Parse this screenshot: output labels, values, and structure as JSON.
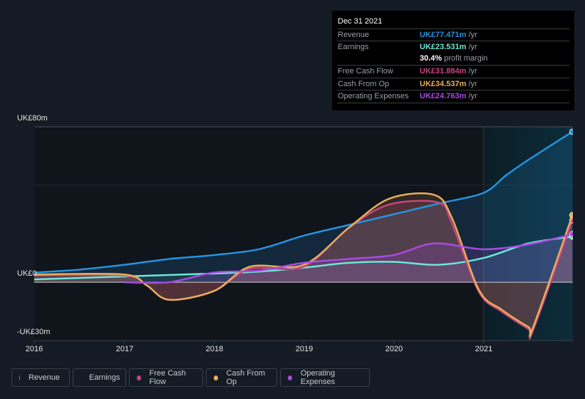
{
  "tooltip": {
    "date": "Dec 31 2021",
    "rows": [
      {
        "label": "Revenue",
        "value": "UK£77.471m",
        "unit": " /yr",
        "color": "#2394df"
      },
      {
        "label": "Earnings",
        "value": "UK£23.531m",
        "unit": " /yr",
        "color": "#6ee7d5"
      },
      {
        "label": "",
        "value": "30.4%",
        "unit": " profit margin",
        "color": "#ffffff"
      },
      {
        "label": "Free Cash Flow",
        "value": "UK£31.884m",
        "unit": " /yr",
        "color": "#c5467e"
      },
      {
        "label": "Cash From Op",
        "value": "UK£34.537m",
        "unit": " /yr",
        "color": "#e9ad5b"
      },
      {
        "label": "Operating Expenses",
        "value": "UK£24.763m",
        "unit": " /yr",
        "color": "#a94ae3"
      }
    ]
  },
  "legend": [
    {
      "label": "Revenue",
      "color": "#2394df"
    },
    {
      "label": "Earnings",
      "color": "#6ee7d5"
    },
    {
      "label": "Free Cash Flow",
      "color": "#c5467e"
    },
    {
      "label": "Cash From Op",
      "color": "#e9ad5b"
    },
    {
      "label": "Operating Expenses",
      "color": "#a94ae3"
    }
  ],
  "chart_data": {
    "type": "area",
    "title": "",
    "xlabel": "",
    "ylabel": "",
    "y_tick_labels": [
      "UK£80m",
      "UK£0",
      "-UK£30m"
    ],
    "y_ticks": [
      80,
      0,
      -30
    ],
    "ylim": [
      -30,
      80
    ],
    "xlim": [
      2016,
      2022
    ],
    "x_tick_labels": [
      "2016",
      "2017",
      "2018",
      "2019",
      "2020",
      "2021"
    ],
    "x_ticks": [
      2016,
      2017,
      2018,
      2019,
      2020,
      2021
    ],
    "highlight_from": 2021,
    "grid": true,
    "legend_position": "bottom-left",
    "series": [
      {
        "name": "Revenue",
        "color": "#2394df",
        "x": [
          2016,
          2016.5,
          2017,
          2017.5,
          2018,
          2018.5,
          2019,
          2019.5,
          2020,
          2020.5,
          2021,
          2021.25,
          2021.5,
          2021.99
        ],
        "y": [
          5,
          6.5,
          9,
          12,
          14,
          17,
          24,
          29.5,
          35,
          40.5,
          46,
          55,
          63,
          77.471
        ]
      },
      {
        "name": "Earnings",
        "color": "#6ee7d5",
        "x": [
          2016,
          2017,
          2018,
          2018.5,
          2019,
          2019.5,
          2020,
          2020.5,
          2021,
          2021.5,
          2021.99
        ],
        "y": [
          1.5,
          3,
          4.5,
          5.5,
          7.5,
          10,
          10.5,
          9,
          12.5,
          20,
          23.531
        ]
      },
      {
        "name": "Free Cash Flow",
        "color": "#c5467e",
        "x": [
          2016,
          2017,
          2017.25,
          2017.5,
          2018,
          2018.4,
          2019,
          2019.5,
          2019.95,
          2020.5,
          2020.65,
          2020.95,
          2021.2,
          2021.5,
          2021.55,
          2021.99
        ],
        "y": [
          3.5,
          3.5,
          -1.5,
          -9,
          -4.5,
          7,
          8,
          28,
          40,
          41,
          30,
          -5,
          -15,
          -24,
          -25,
          31.884
        ]
      },
      {
        "name": "Cash From Op",
        "color": "#e9ad5b",
        "x": [
          2016,
          2017,
          2017.25,
          2017.5,
          2018,
          2018.4,
          2019,
          2019.5,
          2019.95,
          2020.45,
          2020.65,
          2020.95,
          2021.2,
          2021.5,
          2021.55,
          2021.99
        ],
        "y": [
          4,
          4,
          -1.5,
          -9,
          -4.5,
          8,
          9,
          28,
          43,
          45,
          33,
          -4,
          -14,
          -23,
          -23.5,
          34.537
        ]
      },
      {
        "name": "Operating Expenses",
        "color": "#a94ae3",
        "x": [
          2017,
          2017.5,
          2018,
          2018.5,
          2019,
          2019.5,
          2020,
          2020.45,
          2021,
          2021.5,
          2021.99
        ],
        "y": [
          0,
          0,
          5,
          6,
          10,
          12,
          14,
          20,
          17,
          19.5,
          24.763
        ]
      }
    ]
  }
}
